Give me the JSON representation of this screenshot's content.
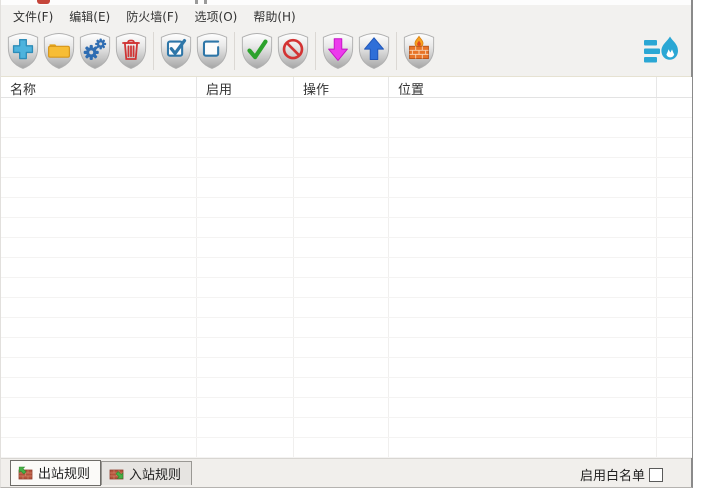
{
  "menu_bar": {
    "items": [
      "文件(F)",
      "编辑(E)",
      "防火墙(F)",
      "选项(O)",
      "帮助(H)"
    ]
  },
  "toolbar": {
    "buttons": [
      {
        "icon": "add-rule-shield-icon"
      },
      {
        "icon": "open-folder-shield-icon"
      },
      {
        "icon": "settings-gears-shield-icon"
      },
      {
        "icon": "delete-trash-shield-icon"
      },
      {
        "icon": "check-all-shield-icon"
      },
      {
        "icon": "uncheck-all-shield-icon"
      },
      {
        "icon": "allow-check-shield-icon"
      },
      {
        "icon": "block-prohibit-shield-icon"
      },
      {
        "icon": "move-down-arrow-shield-icon"
      },
      {
        "icon": "move-up-arrow-shield-icon"
      },
      {
        "icon": "firewall-wall-shield-icon"
      }
    ],
    "logo_icon": "app-flame-list-logo"
  },
  "table": {
    "columns": [
      {
        "label": "名称"
      },
      {
        "label": "启用"
      },
      {
        "label": "操作"
      },
      {
        "label": "位置"
      },
      {
        "label": ""
      }
    ],
    "row_count": 18,
    "rows": []
  },
  "tabs": [
    {
      "label": "出站规则",
      "selected": true
    },
    {
      "label": "入站规则",
      "selected": false
    }
  ],
  "footer": {
    "whitelist_label": "启用白名单",
    "whitelist_checked": false
  },
  "colors": {
    "chrome_bg": "#f2f1ef",
    "add_blue": "#4db3dd",
    "folder_yellow": "#f7bd35",
    "gear_blue": "#2f6db2",
    "trash_red": "#d03434",
    "checkbox_blue": "#2e76a8",
    "allow_green": "#2ca22c",
    "block_red": "#d33333",
    "down_magenta": "#ec3bec",
    "up_blue": "#2f6fd8",
    "firewall_orange": "#e87428",
    "logo_teal": "#2ba7d4",
    "tab_brick": "#b5523c",
    "tab_arrow_green": "#46b046"
  }
}
